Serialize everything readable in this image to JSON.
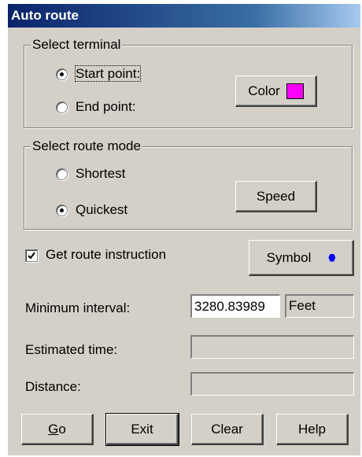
{
  "window": {
    "title": "Auto route"
  },
  "terminal_group": {
    "label": "Select terminal",
    "start_point_label": "Start point:",
    "end_point_label": "End point:",
    "selected": "start",
    "color_button_label": "Color",
    "color_value": "#ff00ff"
  },
  "route_mode_group": {
    "label": "Select route mode",
    "shortest_label": "Shortest",
    "quickest_label": "Quickest",
    "selected": "quickest",
    "speed_button_label": "Speed"
  },
  "instruction": {
    "checkbox_label": "Get route instruction",
    "checked": true,
    "symbol_button_label": "Symbol",
    "symbol_color": "#0000ff"
  },
  "fields": {
    "min_interval_label": "Minimum interval:",
    "min_interval_value": "3280.83989",
    "min_interval_unit": "Feet",
    "estimated_time_label": "Estimated time:",
    "estimated_time_value": "",
    "distance_label": "Distance:",
    "distance_value": ""
  },
  "buttons": {
    "go_rest": "o",
    "go_accel": "G",
    "exit": "Exit",
    "clear": "Clear",
    "help": "Help"
  }
}
